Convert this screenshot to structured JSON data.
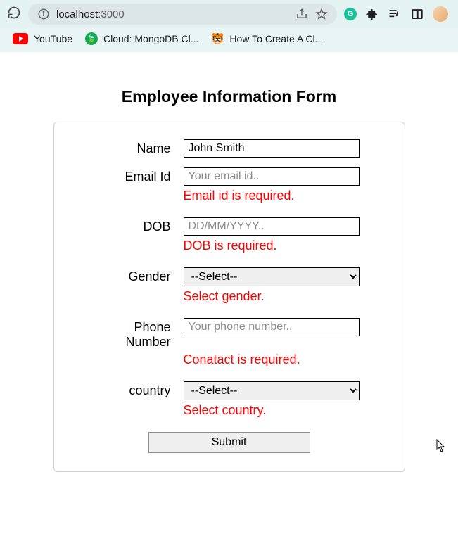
{
  "browser": {
    "url_host": "localhost",
    "url_port": ":3000"
  },
  "bookmarks": {
    "youtube": "YouTube",
    "mongo": "Cloud: MongoDB Cl...",
    "cluster": "How To Create A Cl..."
  },
  "form": {
    "title": "Employee Information Form",
    "name": {
      "label": "Name",
      "value": "John Smith"
    },
    "email": {
      "label": "Email Id",
      "placeholder": "Your email id..",
      "value": "",
      "error": "Email id is required."
    },
    "dob": {
      "label": "DOB",
      "placeholder": "DD/MM/YYYY..",
      "value": "",
      "error": "DOB is required."
    },
    "gender": {
      "label": "Gender",
      "selected": "--Select--",
      "error": "Select gender."
    },
    "phone": {
      "label_line1": "Phone",
      "label_line2": "Number",
      "placeholder": "Your phone number..",
      "value": "",
      "error": "Conatact is required."
    },
    "country": {
      "label": "country",
      "selected": "--Select--",
      "error": "Select country."
    },
    "submit": "Submit"
  }
}
